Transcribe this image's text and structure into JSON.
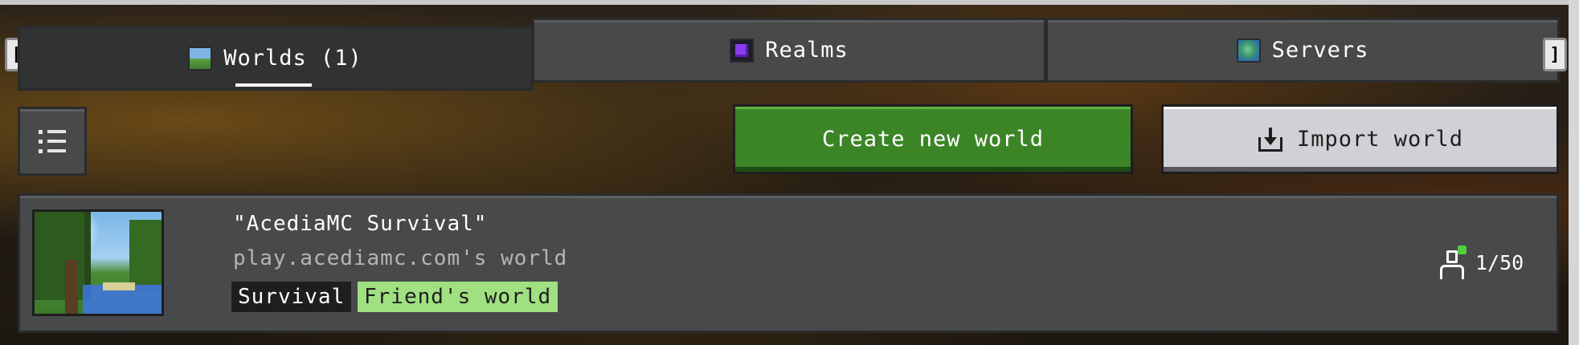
{
  "tabs": [
    {
      "label": "Worlds (1)",
      "icon": "world-icon",
      "active": true
    },
    {
      "label": "Realms",
      "icon": "realms-icon",
      "active": false
    },
    {
      "label": "Servers",
      "icon": "servers-icon",
      "active": false
    }
  ],
  "nav": {
    "left_bracket": "[",
    "right_bracket": "]"
  },
  "toolbar": {
    "menu_icon": "list-icon",
    "create_label": "Create new world",
    "import_label": "Import world",
    "import_icon": "import-icon"
  },
  "world": {
    "title": "\"AcediaMC Survival\"",
    "subtitle": "play.acediamc.com's world",
    "mode_badge": "Survival",
    "type_badge": "Friend's world",
    "players": "1/50"
  },
  "colors": {
    "create_button": "#3c8527",
    "import_button": "#d0d1d4",
    "friend_badge": "#a0e081",
    "tab_bg": "#48494a",
    "active_tab_bg": "#313233",
    "online_dot": "#4fd13a"
  }
}
